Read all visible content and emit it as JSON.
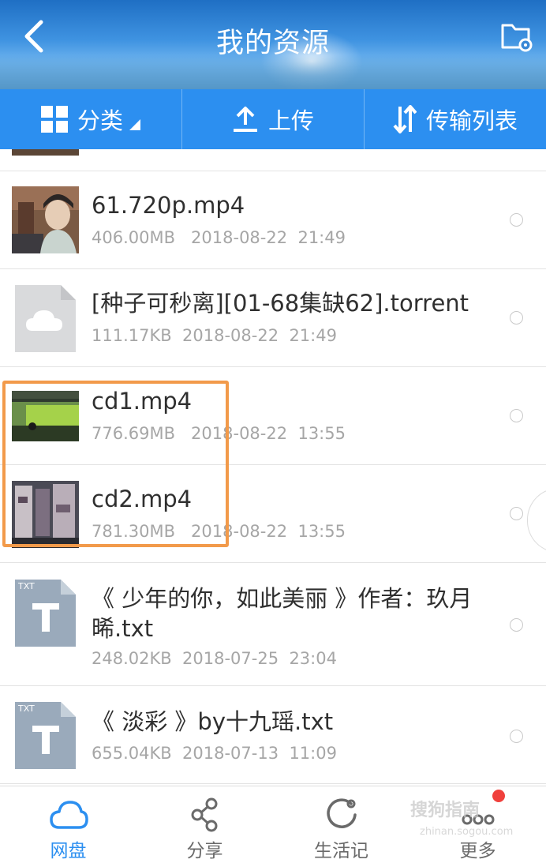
{
  "header": {
    "title": "我的资源",
    "back_icon": "back-arrow-icon",
    "folder_icon": "folder-settings-icon"
  },
  "toolbar": {
    "category_label": "分类",
    "upload_label": "上传",
    "transfer_label": "传输列表"
  },
  "files": [
    {
      "name": "61.720p.mp4",
      "size": "406.00MB",
      "date": "2018-08-22",
      "time": "21:49",
      "type": "video"
    },
    {
      "name": "[种子可秒离][01-68集缺62].torrent",
      "size": "111.17KB",
      "date": "2018-08-22",
      "time": "21:49",
      "type": "torrent"
    },
    {
      "name": "cd1.mp4",
      "size": "776.69MB",
      "date": "2018-08-22",
      "time": "13:55",
      "type": "video"
    },
    {
      "name": "cd2.mp4",
      "size": "781.30MB",
      "date": "2018-08-22",
      "time": "13:55",
      "type": "video"
    },
    {
      "name": "《 少年的你，如此美丽 》作者：玖月晞.txt",
      "size": "248.02KB",
      "date": "2018-07-25",
      "time": "23:04",
      "type": "txt",
      "badge": "TXT"
    },
    {
      "name": "《 淡彩 》by十九瑶.txt",
      "size": "655.04KB",
      "date": "2018-07-13",
      "time": "11:09",
      "type": "txt",
      "badge": "TXT"
    }
  ],
  "bottom_nav": [
    {
      "label": "网盘",
      "icon": "cloud-icon",
      "active": true
    },
    {
      "label": "分享",
      "icon": "share-icon",
      "active": false
    },
    {
      "label": "生活记",
      "icon": "refresh-icon",
      "active": false
    },
    {
      "label": "更多",
      "icon": "more-icon",
      "active": false
    }
  ],
  "colors": {
    "accent": "#2c8ff0",
    "highlight_box": "#f29a4a",
    "badge": "#f0403c"
  },
  "watermark": {
    "text": "搜狗指南",
    "url": "zhinan.sogou.com"
  }
}
